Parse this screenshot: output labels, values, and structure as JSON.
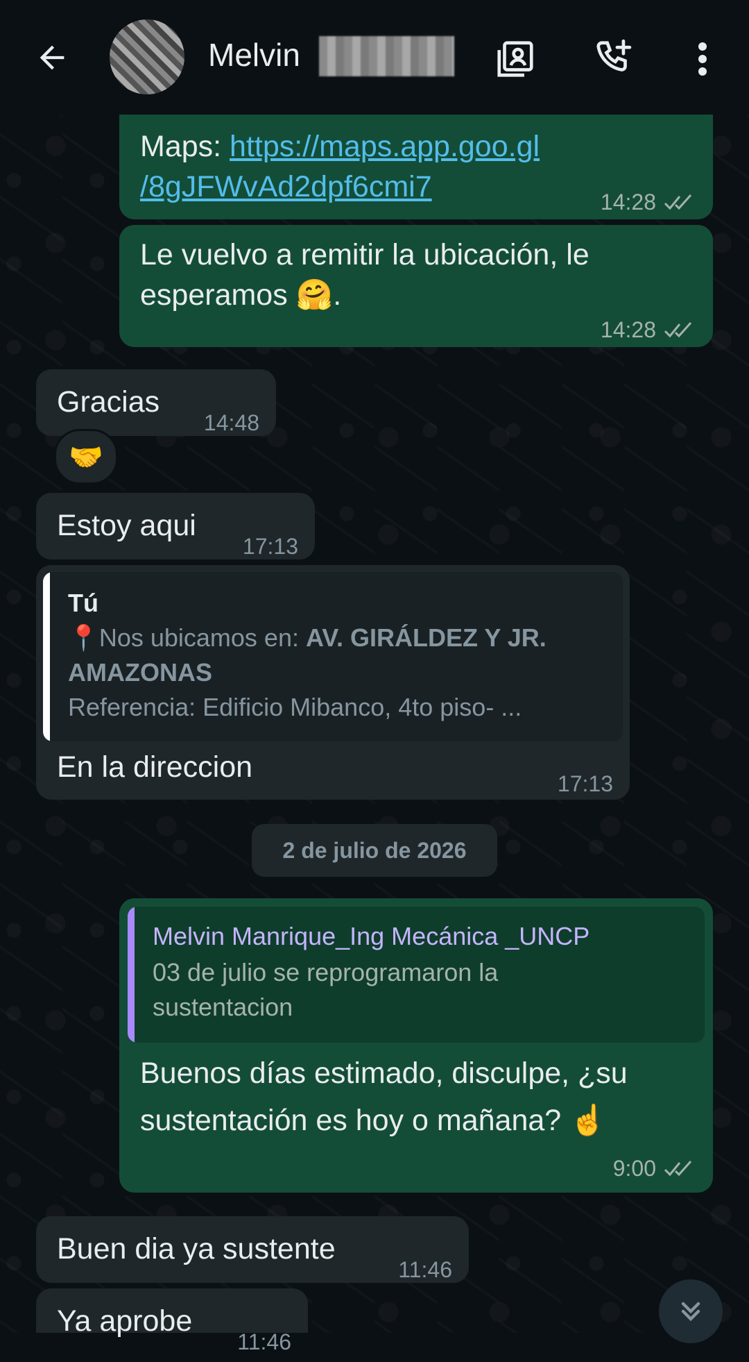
{
  "header": {
    "contact_name": "Melvin",
    "icons": [
      "back-arrow-icon",
      "contact-card-icon",
      "add-call-icon",
      "more-vert-icon"
    ]
  },
  "messages": [
    {
      "direction": "out",
      "prefix": "Maps: ",
      "link": "https://maps.app.goo.gl",
      "link2": "/8gJFWvAd2dpf6cmi7",
      "time": "14:28"
    },
    {
      "direction": "out",
      "text1": "Le vuelvo a remitir la ubicación, le",
      "text2": "esperamos 🤗.",
      "time": "14:28"
    },
    {
      "direction": "in",
      "text": "Gracias",
      "time": "14:48",
      "reaction": "🤝"
    },
    {
      "direction": "in",
      "text": "Estoy aqui",
      "time": "17:13"
    },
    {
      "direction": "in",
      "quote": {
        "author": "Tú",
        "line1_plain": "📍Nos ubicamos en: ",
        "line1_bold": "AV. GIRÁLDEZ Y JR.",
        "line2_bold": "AMAZONAS",
        "line3": "Referencia: Edificio Mibanco, 4to piso- ..."
      },
      "text": "En la direccion",
      "time": "17:13"
    },
    {
      "direction": "out",
      "quote": {
        "author": "Melvin Manrique_Ing Mecánica _UNCP",
        "line1": "03 de julio se reprogramaron la",
        "line2": "sustentacion"
      },
      "text1": "Buenos días estimado, disculpe, ¿su",
      "text2": "sustentación es hoy o mañana? ☝️",
      "time": "9:00"
    },
    {
      "direction": "in",
      "text": "Buen dia ya sustente",
      "time": "11:46"
    },
    {
      "direction": "in",
      "text": "Ya aprobe",
      "time": "11:46"
    }
  ],
  "date_separator": "2 de julio de 2026",
  "colors": {
    "outgoing_bubble": "#144d37",
    "incoming_bubble": "#1f272a",
    "link": "#53bdeb",
    "quote_accent_out": "#a78bfa",
    "quote_accent_in": "#ffffff"
  }
}
